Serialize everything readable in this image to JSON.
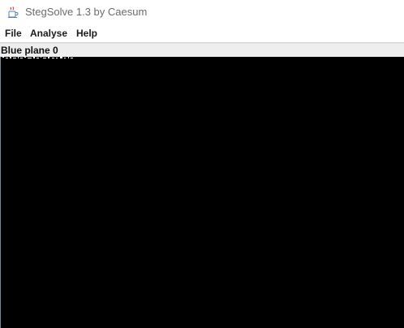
{
  "window": {
    "title": "StegSolve 1.3 by Caesum",
    "icon": "java-coffee-cup-icon"
  },
  "menubar": {
    "items": [
      {
        "label": "File"
      },
      {
        "label": "Analyse"
      },
      {
        "label": "Help"
      }
    ]
  },
  "viewer": {
    "plane_label": "Blue plane 0",
    "background_color": "#000000"
  }
}
